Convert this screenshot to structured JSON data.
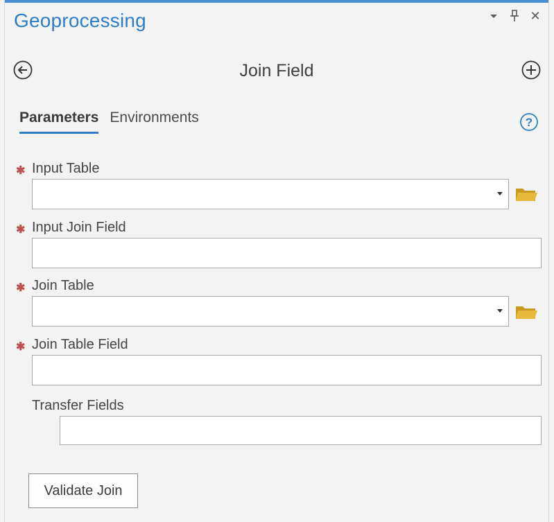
{
  "pane": {
    "title": "Geoprocessing",
    "controls": {
      "menu_icon": "chevron-down-icon",
      "pin_icon": "pin-icon",
      "close_glyph": "✕"
    }
  },
  "tool": {
    "title": "Join Field",
    "back_icon": "back-arrow-icon",
    "add_icon": "add-icon"
  },
  "tabs": [
    {
      "label": "Parameters",
      "active": true
    },
    {
      "label": "Environments",
      "active": false
    }
  ],
  "help_icon": "help-icon",
  "required_marker": "✱",
  "parameters": [
    {
      "label": "Input Table",
      "required": true,
      "value": "",
      "type": "dropdown",
      "browse": true
    },
    {
      "label": "Input Join Field",
      "required": true,
      "value": "",
      "type": "text",
      "browse": false
    },
    {
      "label": "Join Table",
      "required": true,
      "value": "",
      "type": "dropdown",
      "browse": true
    },
    {
      "label": "Join Table Field",
      "required": true,
      "value": "",
      "type": "text",
      "browse": false
    },
    {
      "label": "Transfer Fields",
      "required": false,
      "value": "",
      "type": "text",
      "browse": false
    }
  ],
  "actions": {
    "validate_label": "Validate Join"
  },
  "colors": {
    "accent": "#2d7dc8",
    "required": "#c0504d",
    "folder": "#e7b93a"
  }
}
